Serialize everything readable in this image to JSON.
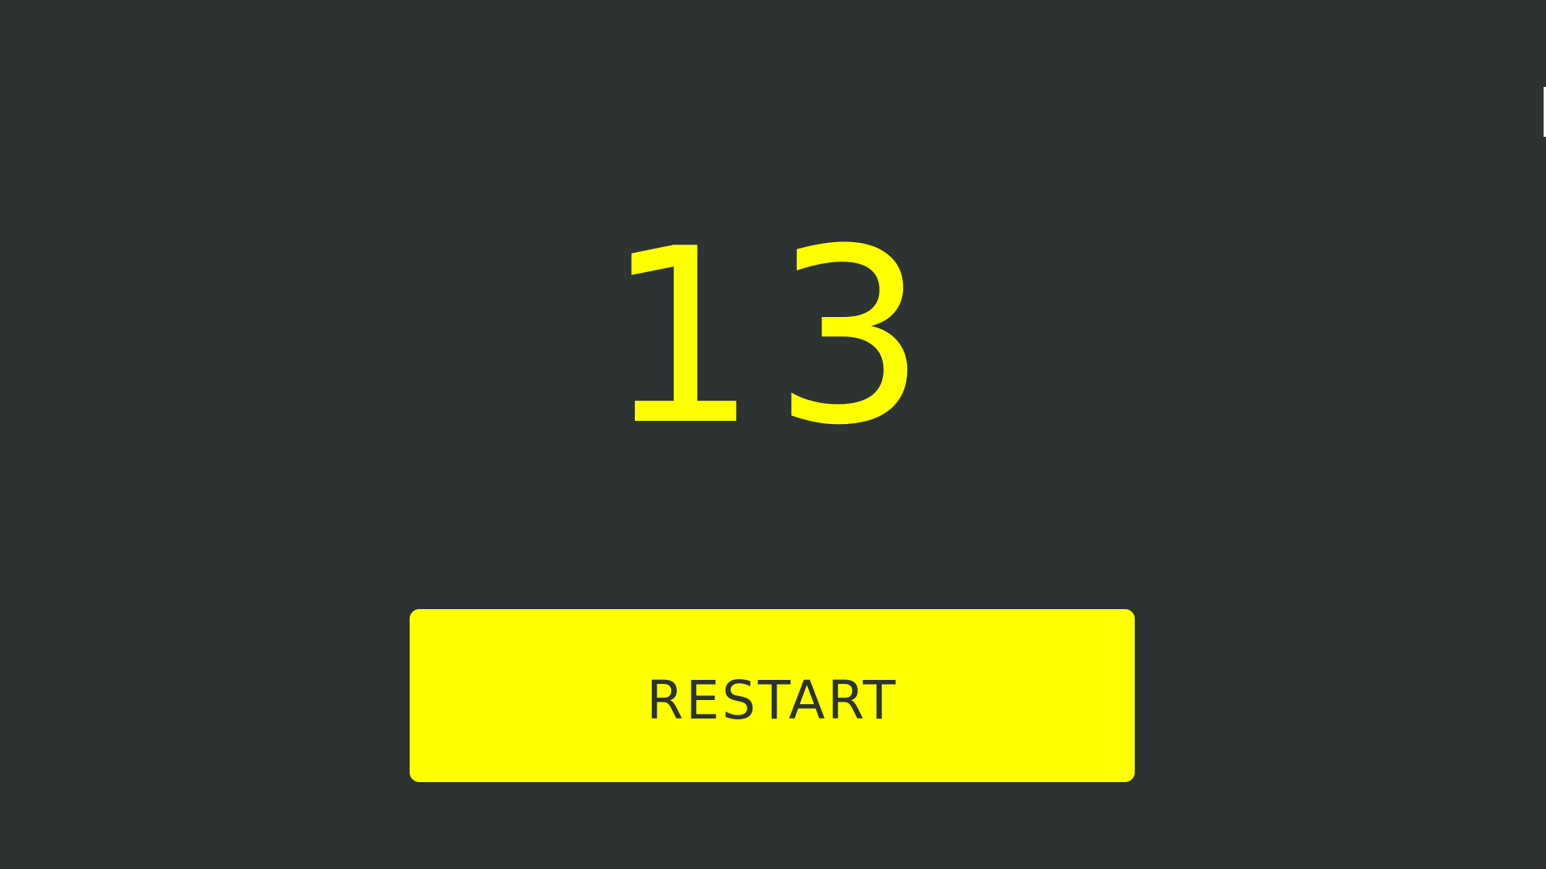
{
  "game": {
    "score": "13",
    "restart_label": "RESTART"
  },
  "colors": {
    "background": "#2d3233",
    "accent": "#ffff00"
  }
}
